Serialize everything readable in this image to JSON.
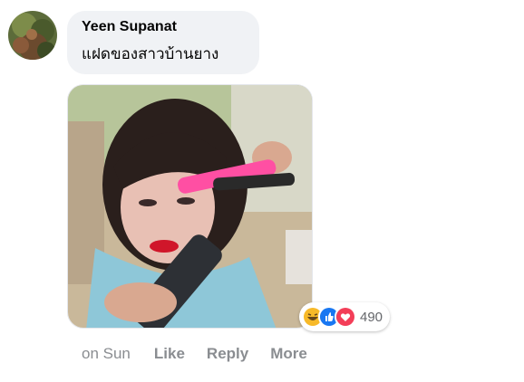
{
  "comment": {
    "author": "Yeen Supanat",
    "text": "แฝดของสาวบ้านยาง",
    "reactions": {
      "icons": [
        "laugh-reaction-icon",
        "like-reaction-icon",
        "love-reaction-icon"
      ],
      "count": "490"
    },
    "timestamp": "on Sun",
    "actions": {
      "like": "Like",
      "reply": "Reply",
      "more": "More"
    }
  },
  "colors": {
    "bubble": "#f0f2f5",
    "like_blue": "#1877f2",
    "love_red": "#f33e58",
    "haha_yellow": "#f7b928",
    "muted_text": "#8a8d91"
  }
}
